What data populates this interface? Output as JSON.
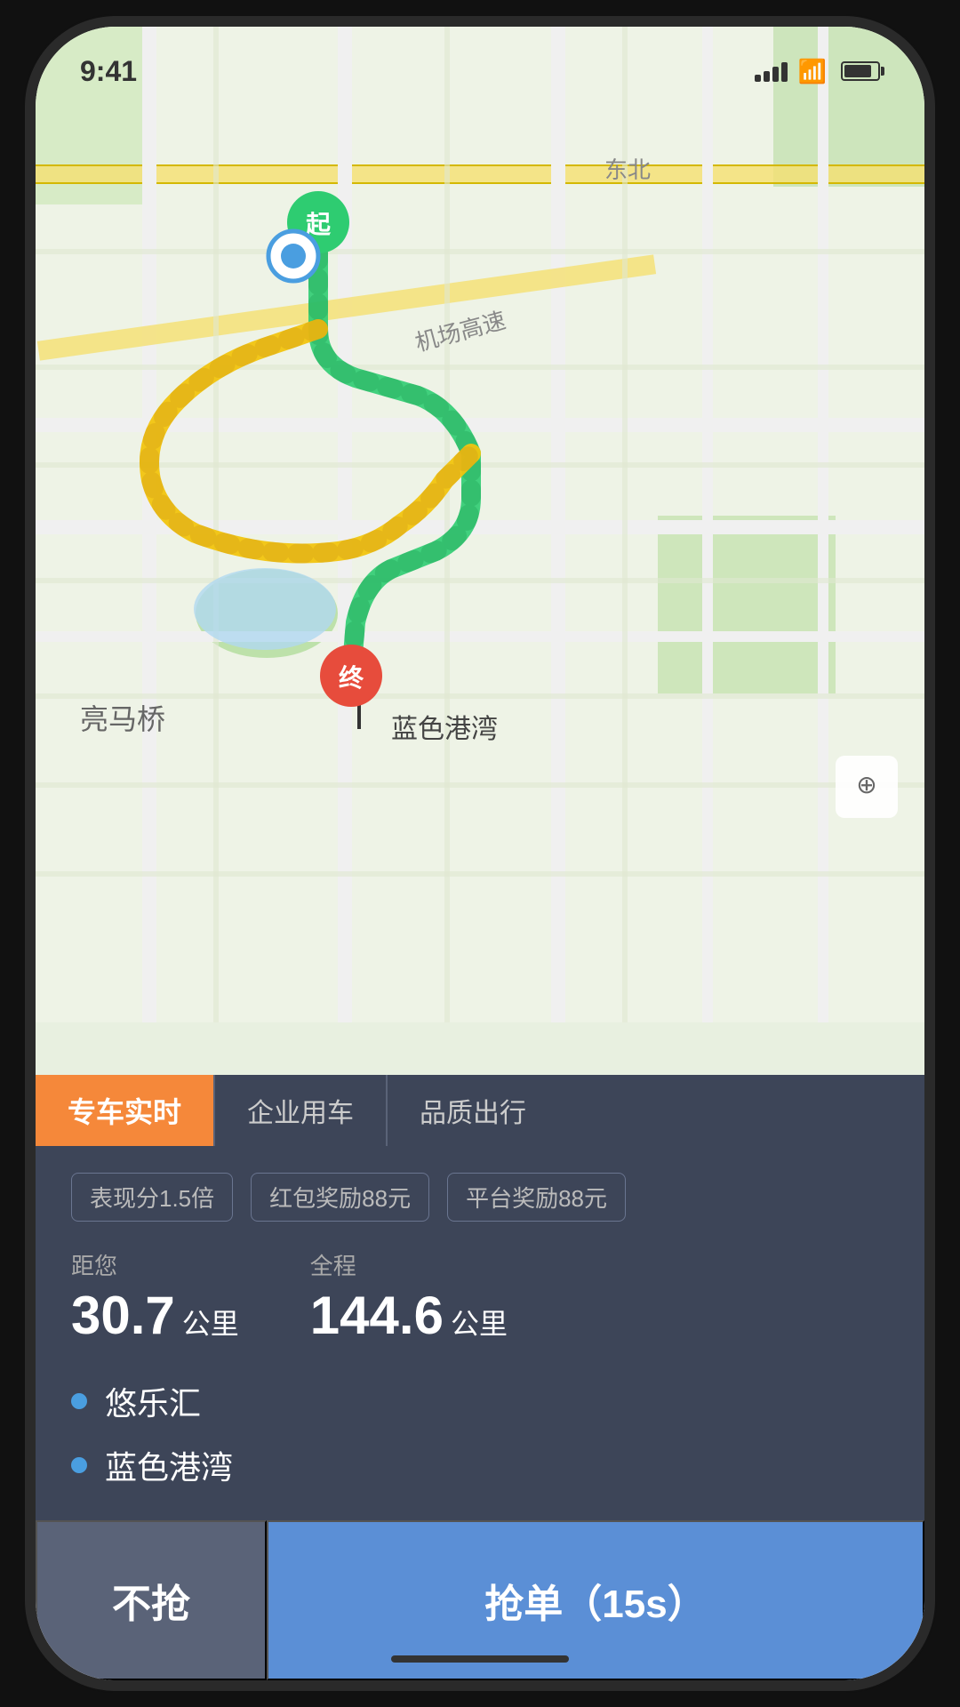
{
  "status_bar": {
    "time": "9:41"
  },
  "map": {
    "start_label": "起",
    "end_label": "终",
    "poi_end_name": "蓝色港湾",
    "area_label": "亮马桥",
    "road_label": "机场高速"
  },
  "tabs": [
    {
      "id": "premium",
      "label": "专车实时",
      "active": true
    },
    {
      "id": "enterprise",
      "label": "企业用车",
      "active": false
    },
    {
      "id": "quality",
      "label": "品质出行",
      "active": false
    }
  ],
  "badges": [
    {
      "id": "performance",
      "text": "表现分1.5倍"
    },
    {
      "id": "red_packet",
      "text": "红包奖励88元"
    },
    {
      "id": "platform",
      "text": "平台奖励88元"
    }
  ],
  "distance_from": {
    "label": "距您",
    "value": "30.7",
    "unit": "公里"
  },
  "distance_total": {
    "label": "全程",
    "value": "144.6",
    "unit": "公里"
  },
  "waypoints": [
    {
      "id": "origin",
      "name": "悠乐汇"
    },
    {
      "id": "destination",
      "name": "蓝色港湾"
    }
  ],
  "buttons": {
    "pass": "不抢",
    "grab": "抢单（15s）"
  }
}
